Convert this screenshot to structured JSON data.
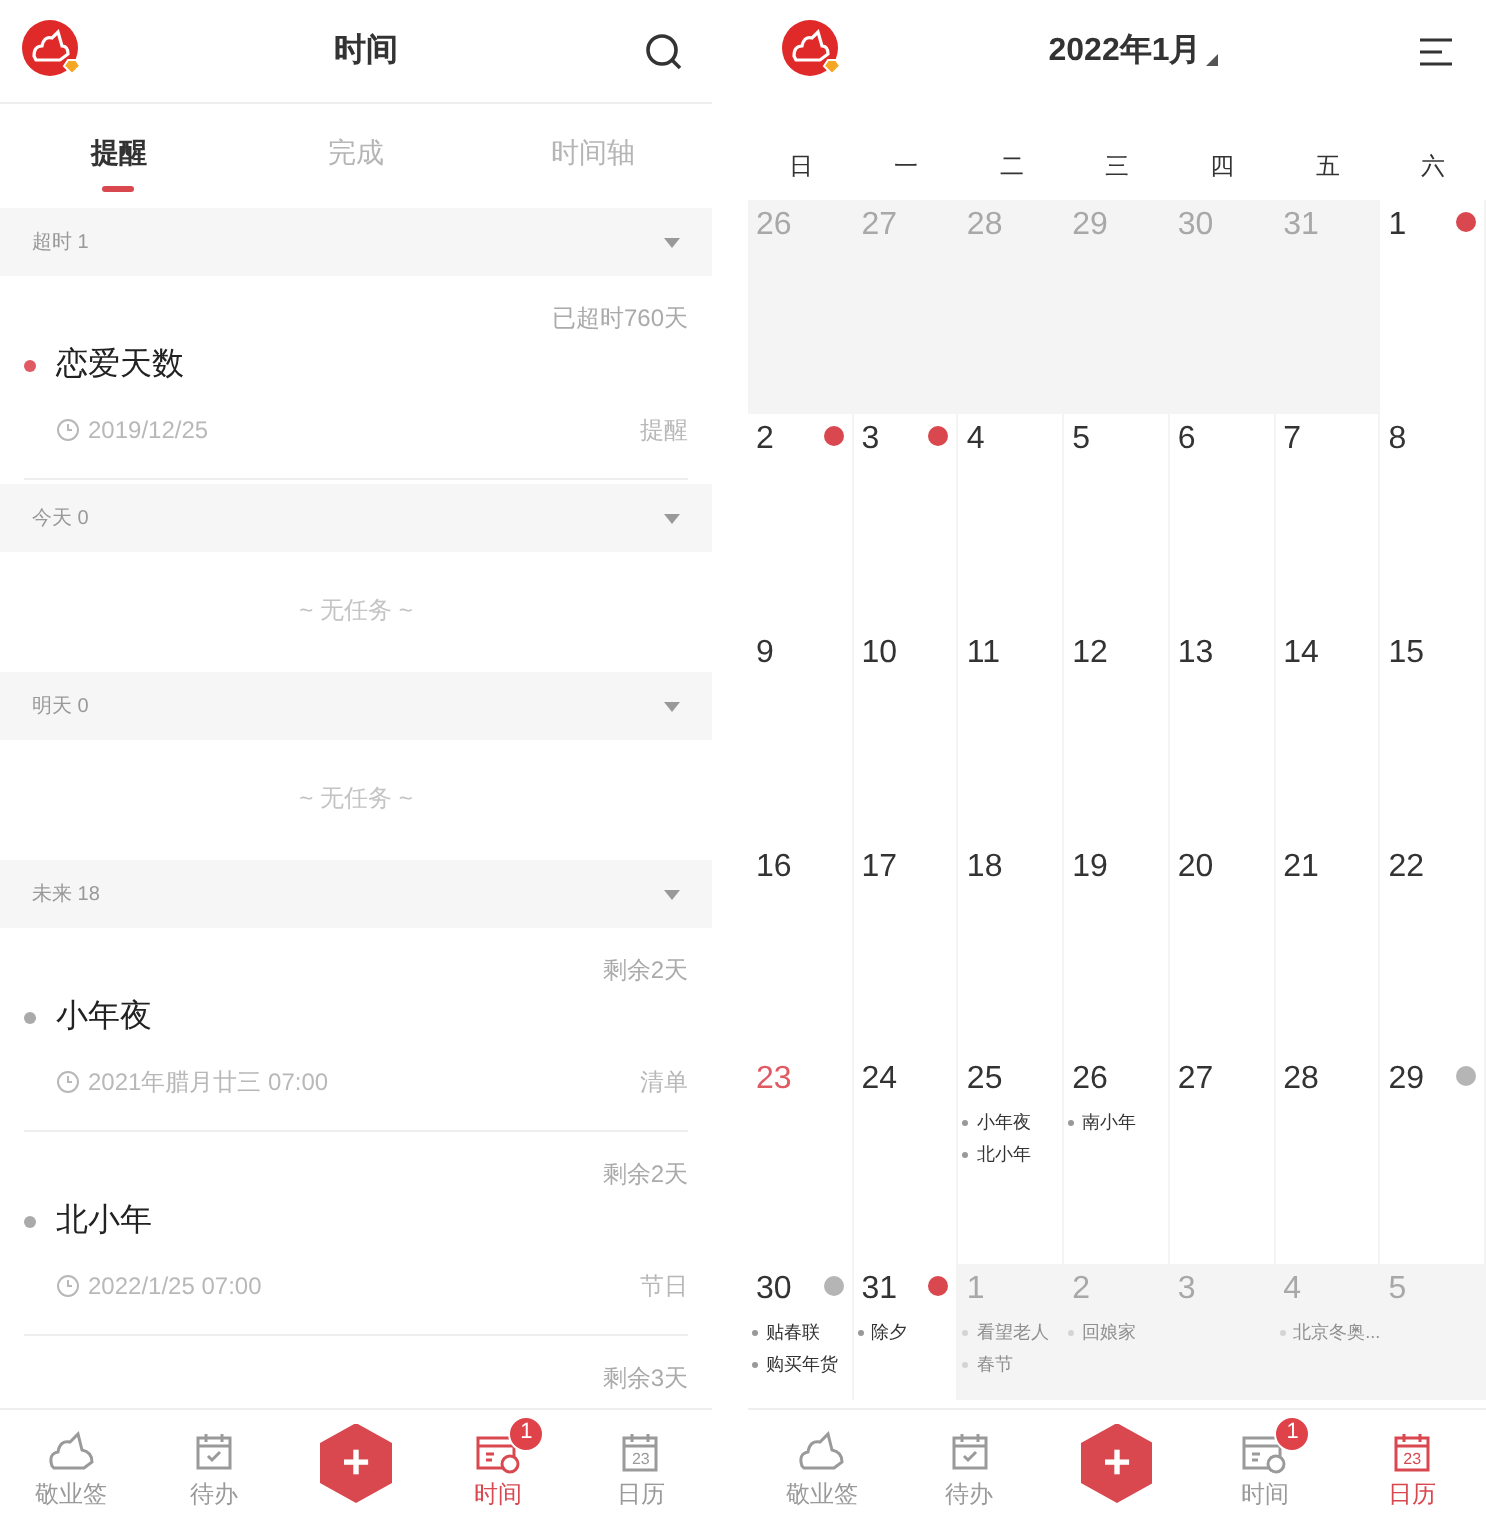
{
  "left": {
    "title": "时间",
    "tabs": [
      {
        "label": "提醒",
        "selected": true
      },
      {
        "label": "完成",
        "selected": false
      },
      {
        "label": "时间轴",
        "selected": false
      }
    ],
    "sections": [
      {
        "label": "超时",
        "count": "1",
        "items": [
          {
            "status": "已超时760天",
            "title": "恋爱天数",
            "date": "2019/12/25",
            "tag": "提醒",
            "color": "#e05a63"
          }
        ]
      },
      {
        "label": "今天",
        "count": "0",
        "empty": "~ 无任务 ~"
      },
      {
        "label": "明天",
        "count": "0",
        "empty": "~ 无任务 ~"
      },
      {
        "label": "未来",
        "count": "18",
        "items": [
          {
            "status": "剩余2天",
            "title": "小年夜",
            "date": "2021年腊月廿三 07:00",
            "tag": "清单",
            "color": "#aaaaaa"
          },
          {
            "status": "剩余2天",
            "title": "北小年",
            "date": "2022/1/25 07:00",
            "tag": "节日",
            "color": "#aaaaaa"
          },
          {
            "status": "剩余3天"
          }
        ]
      }
    ],
    "nav": [
      {
        "kind": "cloud",
        "label": "敬业签",
        "selected": false
      },
      {
        "kind": "todo",
        "label": "待办",
        "selected": false
      },
      {
        "kind": "add",
        "label": "+"
      },
      {
        "kind": "time",
        "label": "时间",
        "selected": true,
        "badge": "1"
      },
      {
        "kind": "calendar",
        "label": "日历",
        "selected": false,
        "icon_text": "23"
      }
    ]
  },
  "right": {
    "title": "2022年1月",
    "weekdays": [
      "日",
      "一",
      "二",
      "三",
      "四",
      "五",
      "六"
    ],
    "days": [
      {
        "day": "26",
        "muted": true
      },
      {
        "day": "27",
        "muted": true
      },
      {
        "day": "28",
        "muted": true
      },
      {
        "day": "29",
        "muted": true
      },
      {
        "day": "30",
        "muted": true
      },
      {
        "day": "31",
        "muted": true
      },
      {
        "day": "1",
        "muted": false,
        "color": "#d9474f"
      },
      {
        "day": "2",
        "muted": false,
        "color": "#d9474f"
      },
      {
        "day": "3",
        "muted": false,
        "color": "#d9474f"
      },
      {
        "day": "4",
        "muted": false
      },
      {
        "day": "5",
        "muted": false
      },
      {
        "day": "6",
        "muted": false
      },
      {
        "day": "7",
        "muted": false
      },
      {
        "day": "8",
        "muted": false
      },
      {
        "day": "9",
        "muted": false
      },
      {
        "day": "10",
        "muted": false
      },
      {
        "day": "11",
        "muted": false
      },
      {
        "day": "12",
        "muted": false
      },
      {
        "day": "13",
        "muted": false
      },
      {
        "day": "14",
        "muted": false
      },
      {
        "day": "15",
        "muted": false
      },
      {
        "day": "16",
        "muted": false
      },
      {
        "day": "17",
        "muted": false
      },
      {
        "day": "18",
        "muted": false
      },
      {
        "day": "19",
        "muted": false
      },
      {
        "day": "20",
        "muted": false
      },
      {
        "day": "21",
        "muted": false
      },
      {
        "day": "22",
        "muted": false
      },
      {
        "day": "23",
        "muted": false,
        "today": true
      },
      {
        "day": "24",
        "muted": false
      },
      {
        "day": "25",
        "muted": false,
        "events": [
          "小年夜",
          "北小年"
        ]
      },
      {
        "day": "26",
        "muted": false,
        "events": [
          "南小年"
        ]
      },
      {
        "day": "27",
        "muted": false
      },
      {
        "day": "28",
        "muted": false
      },
      {
        "day": "29",
        "muted": false,
        "color": "#b5b5b5"
      },
      {
        "day": "30",
        "muted": false,
        "color": "#b5b5b5",
        "events": [
          "贴春联",
          "购买年货"
        ]
      },
      {
        "day": "31",
        "muted": false,
        "color": "#d9474f",
        "events": [
          "除夕"
        ]
      },
      {
        "day": "1",
        "muted": true,
        "events": [
          "看望老人",
          "春节"
        ]
      },
      {
        "day": "2",
        "muted": true,
        "events": [
          "回娘家"
        ]
      },
      {
        "day": "3",
        "muted": true
      },
      {
        "day": "4",
        "muted": true,
        "events": [
          "北京冬奥..."
        ]
      },
      {
        "day": "5",
        "muted": true
      }
    ],
    "nav": [
      {
        "kind": "cloud",
        "label": "敬业签",
        "selected": false
      },
      {
        "kind": "todo",
        "label": "待办",
        "selected": false
      },
      {
        "kind": "add",
        "label": "+"
      },
      {
        "kind": "time",
        "label": "时间",
        "selected": false,
        "badge": "1"
      },
      {
        "kind": "calendar",
        "label": "日历",
        "selected": true,
        "icon_text": "23"
      }
    ]
  }
}
